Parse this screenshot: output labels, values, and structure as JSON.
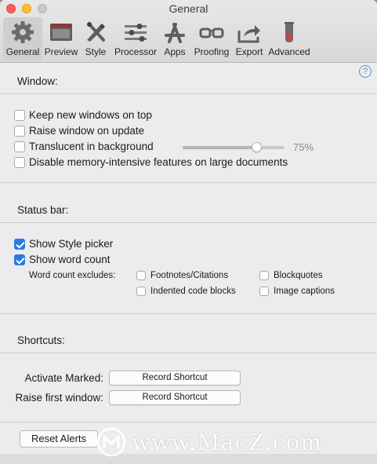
{
  "window": {
    "title": "General"
  },
  "toolbar": {
    "items": [
      {
        "label": "General",
        "icon": "gear-icon",
        "active": true
      },
      {
        "label": "Preview",
        "icon": "preview-window-icon"
      },
      {
        "label": "Style",
        "icon": "pencil-brush-icon"
      },
      {
        "label": "Processor",
        "icon": "sliders-icon"
      },
      {
        "label": "Apps",
        "icon": "app-store-icon"
      },
      {
        "label": "Proofing",
        "icon": "glasses-icon"
      },
      {
        "label": "Export",
        "icon": "share-arrow-icon"
      },
      {
        "label": "Advanced",
        "icon": "test-tube-icon"
      }
    ]
  },
  "help": {
    "glyph": "?"
  },
  "window_section": {
    "title": "Window:",
    "options": [
      {
        "label": "Keep new windows on top",
        "checked": false
      },
      {
        "label": "Raise window on update",
        "checked": false
      },
      {
        "label": "Translucent in background",
        "checked": false
      },
      {
        "label": "Disable memory-intensive features on large documents",
        "checked": false
      }
    ],
    "translucency": {
      "value_label": "75%",
      "fraction": 0.75
    }
  },
  "status_bar": {
    "title": "Status bar:",
    "show_style_picker": {
      "label": "Show Style picker",
      "checked": true
    },
    "show_word_count": {
      "label": "Show word count",
      "checked": true
    },
    "excludes_label": "Word count excludes:",
    "excludes": [
      {
        "label": "Footnotes/Citations",
        "checked": false
      },
      {
        "label": "Blockquotes",
        "checked": false
      },
      {
        "label": "Indented code blocks",
        "checked": false
      },
      {
        "label": "Image captions",
        "checked": false
      }
    ]
  },
  "shortcuts": {
    "title": "Shortcuts:",
    "activate_label": "Activate Marked:",
    "raise_label": "Raise first window:",
    "record_label": "Record Shortcut"
  },
  "footer": {
    "reset_label": "Reset Alerts"
  },
  "watermark": {
    "text": "www.MacZ.com"
  },
  "colors": {
    "accent": "#2a7ae4",
    "close": "#ff5f57",
    "minimize": "#febc2e"
  }
}
